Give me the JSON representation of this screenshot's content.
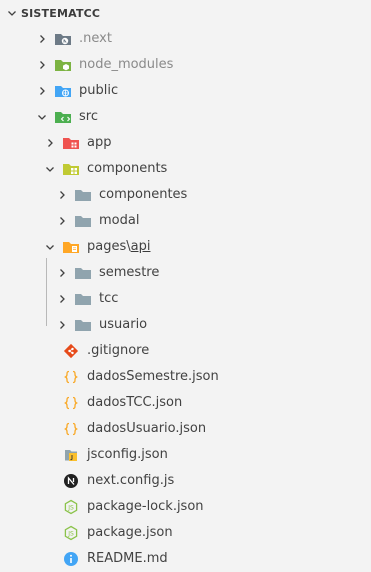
{
  "explorer": {
    "root_label": "SISTEMATCC",
    "items": [
      {
        "label": ".next",
        "kind": "folder",
        "icon": "next-folder-icon",
        "color": "#6d7a86",
        "muted": true
      },
      {
        "label": "node_modules",
        "kind": "folder",
        "icon": "node-modules-folder-icon",
        "color": "#7cb342",
        "muted": true
      },
      {
        "label": "public",
        "kind": "folder",
        "icon": "public-folder-icon",
        "color": "#42a5f5"
      },
      {
        "label": "src",
        "kind": "folder",
        "icon": "src-folder-icon",
        "color": "#4caf50"
      },
      {
        "label": "app",
        "kind": "folder",
        "icon": "app-folder-icon",
        "color": "#ef5350"
      },
      {
        "label": "components",
        "kind": "folder",
        "icon": "components-folder-icon",
        "color": "#c0ca33"
      },
      {
        "label": "componentes",
        "kind": "folder",
        "icon": "folder-icon",
        "color": "#90a4ae"
      },
      {
        "label": "modal",
        "kind": "folder",
        "icon": "folder-icon",
        "color": "#90a4ae"
      },
      {
        "label": "pages",
        "label_suffix": "api",
        "kind": "folder",
        "icon": "pages-folder-icon",
        "color": "#ffa726"
      },
      {
        "label": "semestre",
        "kind": "folder",
        "icon": "folder-icon",
        "color": "#90a4ae"
      },
      {
        "label": "tcc",
        "kind": "folder",
        "icon": "folder-icon",
        "color": "#90a4ae"
      },
      {
        "label": "usuario",
        "kind": "folder",
        "icon": "folder-icon",
        "color": "#90a4ae"
      },
      {
        "label": ".gitignore",
        "kind": "file",
        "icon": "git-icon",
        "color": "#e64a19"
      },
      {
        "label": "dadosSemestre.json",
        "kind": "file",
        "icon": "json-braces-icon",
        "color": "#f9a825"
      },
      {
        "label": "dadosTCC.json",
        "kind": "file",
        "icon": "json-braces-icon",
        "color": "#f9a825"
      },
      {
        "label": "dadosUsuario.json",
        "kind": "file",
        "icon": "json-braces-icon",
        "color": "#f9a825"
      },
      {
        "label": "jsconfig.json",
        "kind": "file",
        "icon": "jsconfig-icon",
        "color": "#fbc02d"
      },
      {
        "label": "next.config.js",
        "kind": "file",
        "icon": "nextjs-icon",
        "color": "#212121"
      },
      {
        "label": "package-lock.json",
        "kind": "file",
        "icon": "npm-package-icon",
        "color": "#8bc34a"
      },
      {
        "label": "package.json",
        "kind": "file",
        "icon": "npm-package-icon",
        "color": "#8bc34a"
      },
      {
        "label": "README.md",
        "kind": "file",
        "icon": "info-icon",
        "color": "#42a5f5"
      }
    ]
  }
}
